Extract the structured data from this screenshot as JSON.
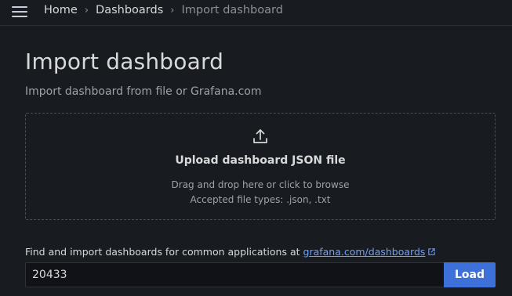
{
  "breadcrumb": {
    "items": [
      {
        "label": "Home"
      },
      {
        "label": "Dashboards"
      },
      {
        "label": "Import dashboard"
      }
    ],
    "separator": "›"
  },
  "header": {
    "title": "Import dashboard",
    "subtitle": "Import dashboard from file or Grafana.com"
  },
  "upload": {
    "icon": "upload-icon",
    "title": "Upload dashboard JSON file",
    "hint": "Drag and drop here or click to browse",
    "accepted": "Accepted file types: .json, .txt"
  },
  "grafana_com": {
    "prompt": "Find and import dashboards for common applications at",
    "link_text": "grafana.com/dashboards",
    "link_icon": "external-link-icon",
    "input_value": "20433",
    "load_label": "Load"
  },
  "colors": {
    "background": "#181b1f",
    "accent": "#3d71d9",
    "link": "#6e9fff",
    "input_background": "#111217"
  }
}
